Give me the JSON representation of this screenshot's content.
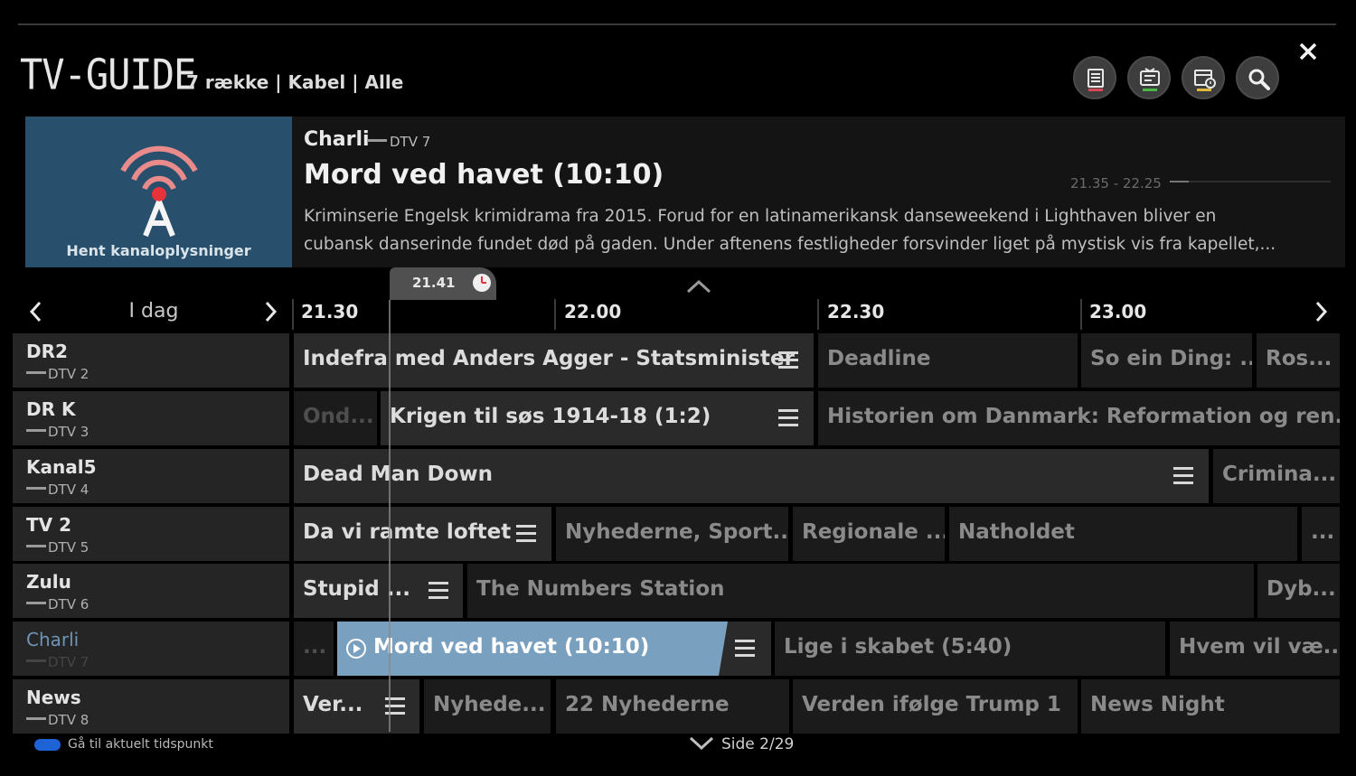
{
  "header": {
    "app_title": "TV-GUIDE",
    "subtitle": "7 række | Kabel | Alle",
    "buttons": [
      {
        "name": "program-list-icon",
        "accent": "#d9485a"
      },
      {
        "name": "recording-icon",
        "accent": "#4cb548"
      },
      {
        "name": "schedule-icon",
        "accent": "#e0b93a"
      },
      {
        "name": "search-icon",
        "accent": ""
      }
    ]
  },
  "info": {
    "thumbnail_label": "Hent kanaloplysninger",
    "channel": "Charli",
    "dtv": "DTV 7",
    "title": "Mord ved havet (10:10)",
    "time_range": "21.35 - 22.25",
    "progress": 0.12,
    "description_line1": "Kriminserie Engelsk krimidrama fra 2015. Forud for en latinamerikansk danseweekend i Lighthaven bliver en",
    "description_line2": "cubansk danserinde fundet død på gaden. Under aftenens festligheder forsvinder liget på mystisk vis fra kapellet,..."
  },
  "timeline": {
    "day": "I dag",
    "now": "21.41",
    "ticks": [
      "21.30",
      "22.00",
      "22.30",
      "23.00"
    ]
  },
  "channels": [
    {
      "name": "DR2",
      "dtv": "DTV 2"
    },
    {
      "name": "DR K",
      "dtv": "DTV 3"
    },
    {
      "name": "Kanal5",
      "dtv": "DTV 4"
    },
    {
      "name": "TV 2",
      "dtv": "DTV 5"
    },
    {
      "name": "Zulu",
      "dtv": "DTV 6"
    },
    {
      "name": "Charli",
      "dtv": "DTV 7"
    },
    {
      "name": "News",
      "dtv": "DTV 8"
    }
  ],
  "programs": {
    "dr2": [
      "Indefra med Anders Agger - Statsminister",
      "Deadline",
      "So ein Ding: ...",
      "Ros..."
    ],
    "drk": [
      "Ond...",
      "Krigen til søs 1914-18 (1:2)",
      "Historien om Danmark: Reformation og ren..."
    ],
    "kanal5": [
      "Dead Man Down",
      "Crimina..."
    ],
    "tv2": [
      "Da vi ramte loftet",
      "Nyhederne, Sport...",
      "Regionale ...",
      "Natholdet",
      "..."
    ],
    "zulu": [
      "Stupid ...",
      "The Numbers Station",
      "Dyb..."
    ],
    "charli": [
      "...",
      "Mord ved havet (10:10)",
      "Lige i skabet (5:40)",
      "Hvem vil væ..."
    ],
    "news": [
      "Ver...",
      "Nyhede...",
      "22 Nyhederne",
      "Verden ifølge Trump 1",
      "News Night"
    ]
  },
  "footer": {
    "goto_now": "Gå til aktuelt tidspunkt",
    "page": "Side 2/29"
  },
  "colors": {
    "selected_program": "#7aa0c0",
    "selected_channel_text": "#6f94b5",
    "blue_button": "#1e63d6"
  }
}
